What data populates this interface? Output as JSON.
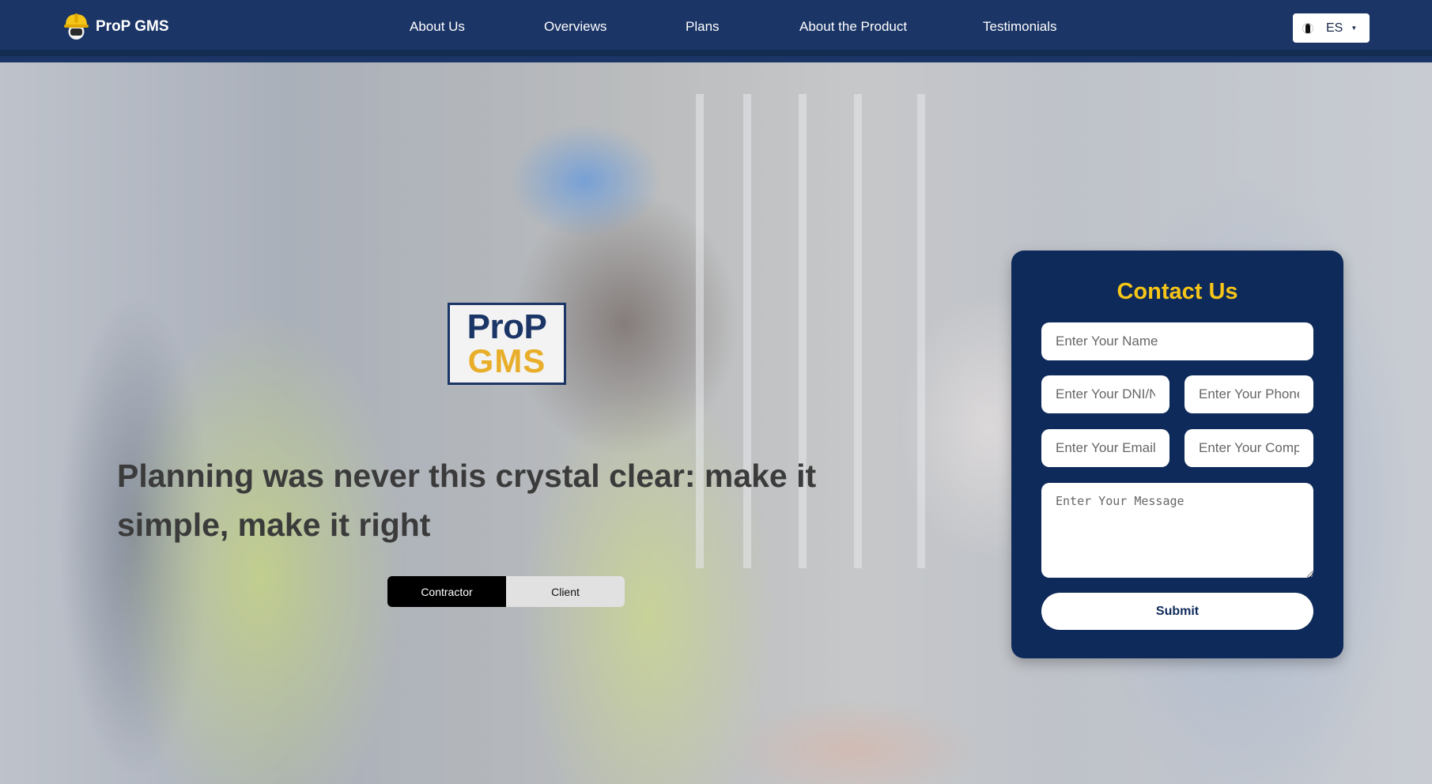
{
  "nav": {
    "brand": "ProP GMS",
    "links": [
      "About Us",
      "Overviews",
      "Plans",
      "About the Product",
      "Testimonials"
    ],
    "language": {
      "selected": "ES"
    }
  },
  "hero": {
    "logo": {
      "line1": "ProP",
      "line2": "GMS"
    },
    "headline": "Planning was never this crystal clear: make it simple, make it right",
    "toggle": {
      "contractor": "Contractor",
      "client": "Client",
      "active": "contractor"
    }
  },
  "contact": {
    "title": "Contact Us",
    "placeholders": {
      "name": "Enter Your Name",
      "dni": "Enter Your DNI/NIE",
      "phone": "Enter Your Phone",
      "email": "Enter Your Email",
      "company": "Enter Your Company",
      "message": "Enter Your Message"
    },
    "submit": "Submit"
  },
  "colors": {
    "navbar": "#1b3566",
    "card": "#0e2a5a",
    "accent_yellow": "#f5c518",
    "logo_gold": "#e8ae2a"
  }
}
